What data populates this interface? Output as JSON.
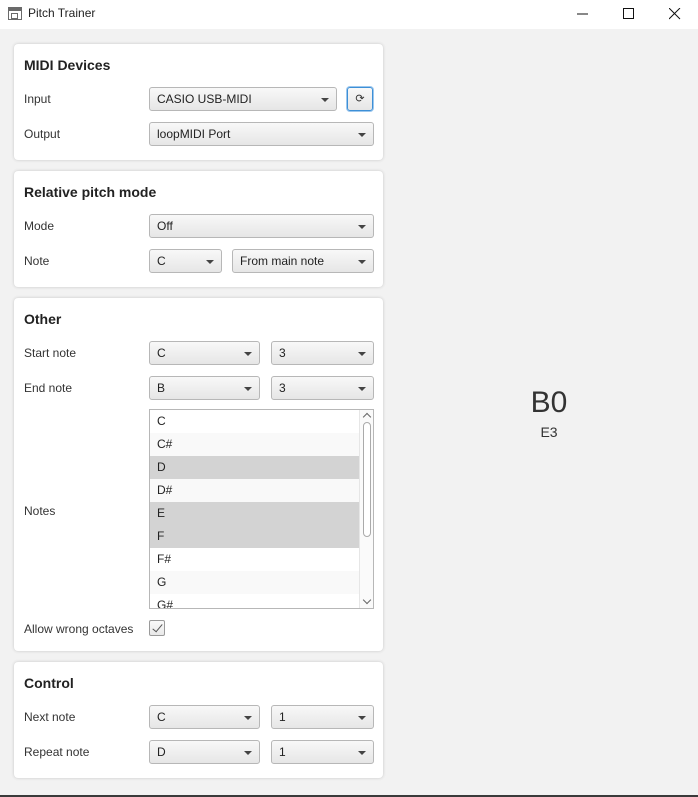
{
  "window": {
    "title": "Pitch Trainer"
  },
  "midi": {
    "title": "MIDI Devices",
    "input_label": "Input",
    "input_value": "CASIO USB-MIDI",
    "refresh_icon": "⟳",
    "output_label": "Output",
    "output_value": "loopMIDI Port"
  },
  "relative": {
    "title": "Relative pitch mode",
    "mode_label": "Mode",
    "mode_value": "Off",
    "note_label": "Note",
    "note_value": "C",
    "from_value": "From main note"
  },
  "other": {
    "title": "Other",
    "start_label": "Start note",
    "start_note": "C",
    "start_octave": "3",
    "end_label": "End note",
    "end_note": "B",
    "end_octave": "3",
    "notes_label": "Notes",
    "notes": [
      "C",
      "C#",
      "D",
      "D#",
      "E",
      "F",
      "F#",
      "G",
      "G#"
    ],
    "allow_label": "Allow wrong octaves",
    "allow_checked": true
  },
  "control": {
    "title": "Control",
    "next_label": "Next note",
    "next_note": "C",
    "next_octave": "1",
    "repeat_label": "Repeat note",
    "repeat_note": "D",
    "repeat_octave": "1"
  },
  "display": {
    "current": "B0",
    "target": "E3"
  }
}
